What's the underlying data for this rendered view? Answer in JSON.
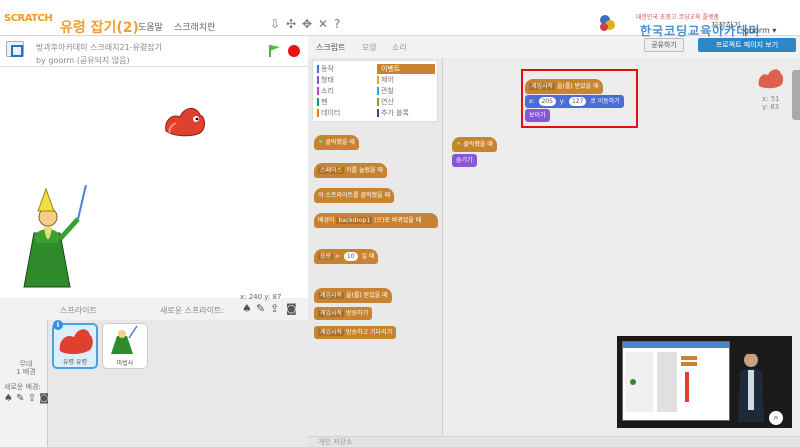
{
  "menubar": {
    "logo": "SCRATCH",
    "project_title": "유령 잡기(2)",
    "menu_items": [
      "도움말",
      "스크래치란"
    ],
    "brand_tagline": "대한민국 초중고 코딩교육 플랫폼",
    "brand_name": "한국코딩교육아카데미",
    "save_status": "저장하기",
    "user": "goorm ▾"
  },
  "stage": {
    "project_path": "방과후아카데미 스크래치21-유령잡기",
    "author": "by goorm (공유되지 않음)",
    "coords": "x: 240  y: 87"
  },
  "sprites": {
    "title": "스프라이트",
    "new_sprite": "새로운 스프라이트:",
    "stage_label": "무대\n1 배경",
    "backdrop_label": "새로운 배경:",
    "items": [
      {
        "name": "유령 유령",
        "selected": true
      },
      {
        "name": "마법사",
        "selected": false
      }
    ]
  },
  "tabs": [
    "스크립트",
    "모양",
    "소리"
  ],
  "categories": [
    {
      "label": "동작",
      "color": "#4a6cd4",
      "active": false
    },
    {
      "label": "형태",
      "color": "#8a55d7",
      "active": false
    },
    {
      "label": "소리",
      "color": "#bb42c3",
      "active": false
    },
    {
      "label": "펜",
      "color": "#0e9a6c",
      "active": false
    },
    {
      "label": "데이터",
      "color": "#ee7d16",
      "active": false
    },
    {
      "label": "이벤트",
      "color": "#c88330",
      "active": true
    },
    {
      "label": "제어",
      "color": "#e1a91a",
      "active": false
    },
    {
      "label": "관찰",
      "color": "#2ca5e2",
      "active": false
    },
    {
      "label": "연산",
      "color": "#5cb712",
      "active": false
    },
    {
      "label": "추가 블록",
      "color": "#632d99",
      "active": false
    }
  ],
  "palette_blocks": {
    "flag_clicked": "클릭했을 때",
    "key_pressed_a": "스페이스",
    "key_pressed_b": "키를 눌렀을 때",
    "sprite_clicked": "이 스프라이트를 클릭했을 때",
    "backdrop_a": "배경이",
    "backdrop_b": "backdrop1",
    "backdrop_c": "(으)로 바뀌었을 때",
    "sensor_a": "음량",
    "sensor_b": ">",
    "sensor_c": "10",
    "sensor_d": "일 때",
    "receive_a": "게임시작",
    "receive_b": "을(를) 받았을 때",
    "broadcast_a": "게임시작",
    "broadcast_b": "방송하기",
    "broadcast_wait_a": "게임시작",
    "broadcast_wait_b": "방송하고 기다리기"
  },
  "scripts": {
    "share_button": "공유하기",
    "project_page_button": "프로젝트 페이지 보기",
    "script1_receive_a": "게임시작",
    "script1_receive_b": "을(를) 받았을 때",
    "script1_goto_a": "x:",
    "script1_goto_x": "205",
    "script1_goto_b": "y:",
    "script1_goto_y": "127",
    "script1_goto_c": "로 이동하기",
    "script1_show": "보이기",
    "script2_flag": "클릭했을 때",
    "script2_hide": "숨기기",
    "sprite_x": "x: 51",
    "sprite_y": "y: 83",
    "footer": "개인 저장소"
  }
}
